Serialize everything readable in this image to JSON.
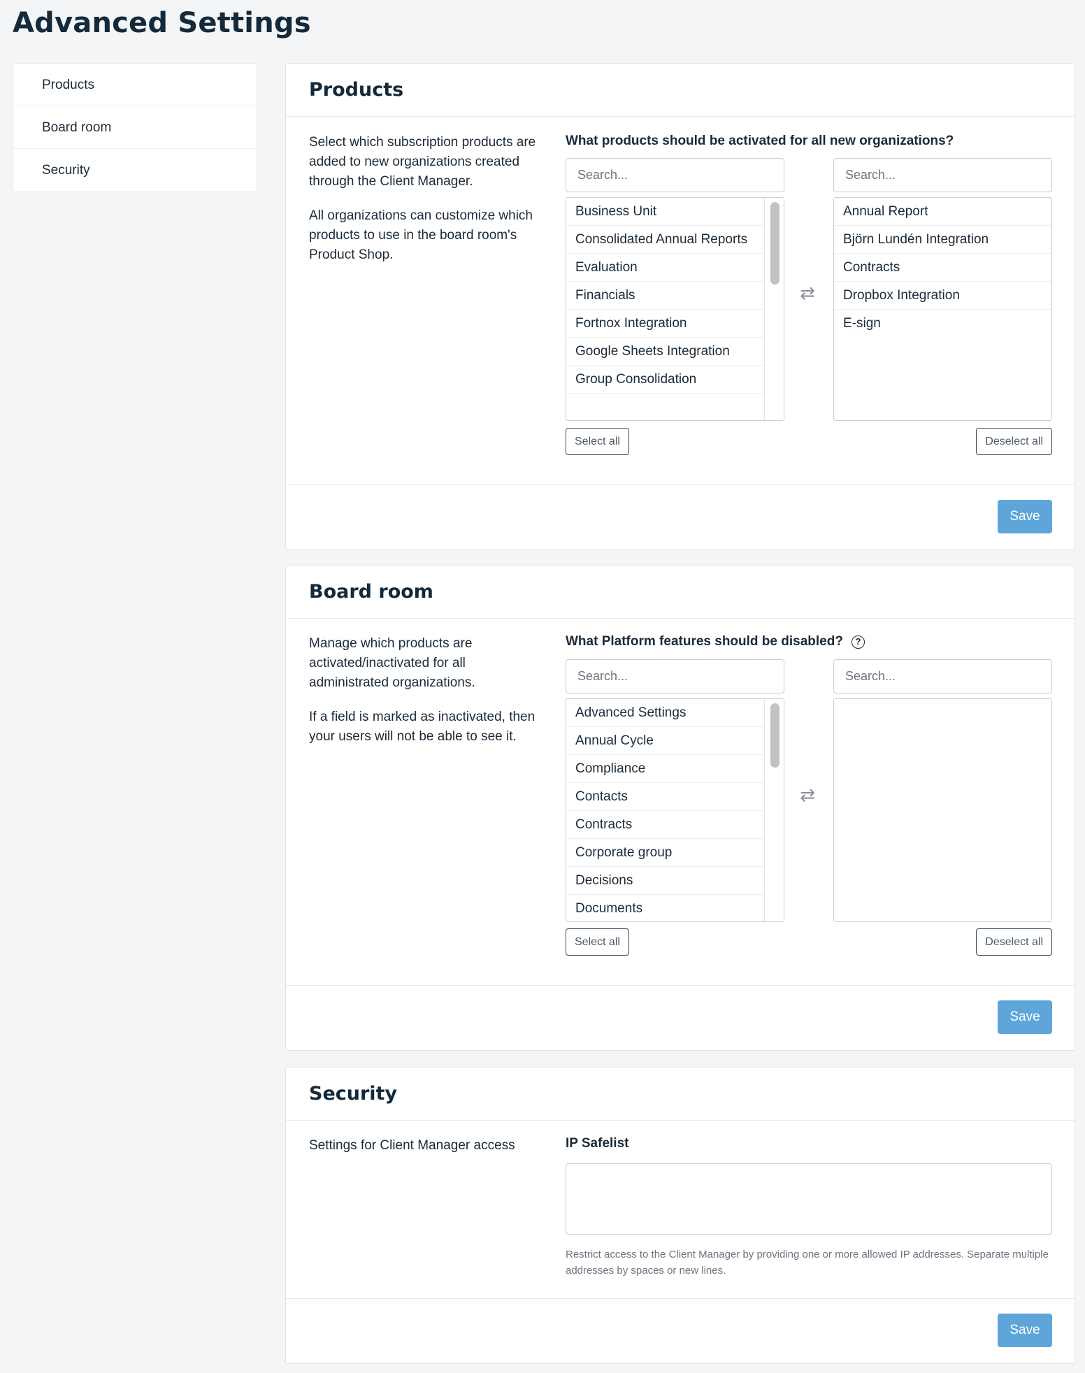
{
  "page": {
    "title": "Advanced Settings"
  },
  "sidebar": {
    "items": [
      {
        "label": "Products"
      },
      {
        "label": "Board room"
      },
      {
        "label": "Security"
      }
    ]
  },
  "products": {
    "title": "Products",
    "description": [
      "Select which subscription products are added to new organizations created through the Client Manager.",
      "All organizations can customize which products to use in the board room's Product Shop."
    ],
    "question": "What products should be activated for all new organizations?",
    "left_search_placeholder": "Search...",
    "right_search_placeholder": "Search...",
    "available": [
      "Business Unit",
      "Consolidated Annual Reports",
      "Evaluation",
      "Financials",
      "Fortnox Integration",
      "Google Sheets Integration",
      "Group Consolidation"
    ],
    "selected": [
      "Annual Report",
      "Björn Lundén Integration",
      "Contracts",
      "Dropbox Integration",
      "E-sign"
    ],
    "select_all_label": "Select all",
    "deselect_all_label": "Deselect all",
    "save_label": "Save"
  },
  "board_room": {
    "title": "Board room",
    "description": [
      "Manage which products are activated/inactivated for all administrated organizations.",
      "If a field is marked as inactivated, then your users will not be able to see it."
    ],
    "question": "What Platform features should be disabled?",
    "help_icon": "question-circle-icon",
    "left_search_placeholder": "Search...",
    "right_search_placeholder": "Search...",
    "available": [
      "Advanced Settings",
      "Annual Cycle",
      "Compliance",
      "Contacts",
      "Contracts",
      "Corporate group",
      "Decisions",
      "Documents"
    ],
    "selected": [],
    "select_all_label": "Select all",
    "deselect_all_label": "Deselect all",
    "save_label": "Save"
  },
  "security": {
    "title": "Security",
    "description": "Settings for Client Manager access",
    "field_label": "IP Safelist",
    "ip_value": "",
    "helper_text": "Restrict access to the Client Manager by providing one or more allowed IP addresses. Separate multiple addresses by spaces or new lines.",
    "save_label": "Save"
  },
  "colors": {
    "accent": "#5ea6d9",
    "text": "#1b2a38",
    "border": "#c9ced4"
  }
}
